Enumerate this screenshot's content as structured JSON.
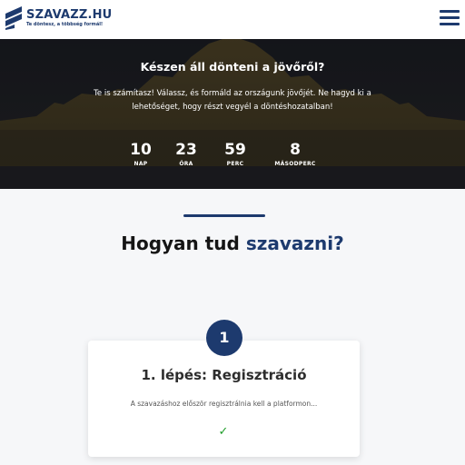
{
  "header": {
    "logo_title": "SZAVAZZ.HU",
    "logo_tagline": "Te döntesz, a többség formál!",
    "brand_color": "#1d3a6e"
  },
  "hero": {
    "title": "Készen áll dönteni a jövőről?",
    "text": "Te is számítasz! Válassz, és formáld az országunk jövőjét. Ne hagyd ki a lehetőséget, hogy részt vegyél a döntéshozatalban!",
    "countdown": [
      {
        "value": "10",
        "label": "NAP"
      },
      {
        "value": "23",
        "label": "ÓRA"
      },
      {
        "value": "59",
        "label": "PERC"
      },
      {
        "value": "8",
        "label": "MÁSODPERC"
      }
    ]
  },
  "section": {
    "title_main": "Hogyan tud",
    "title_accent": "szavazni?",
    "steps": [
      {
        "number": "1",
        "title": "1. lépés: Regisztráció",
        "text": "A szavazáshoz először regisztrálnia kell a platformon...",
        "status_icon": "check-icon",
        "status_color": "#1f9d2a"
      }
    ]
  }
}
